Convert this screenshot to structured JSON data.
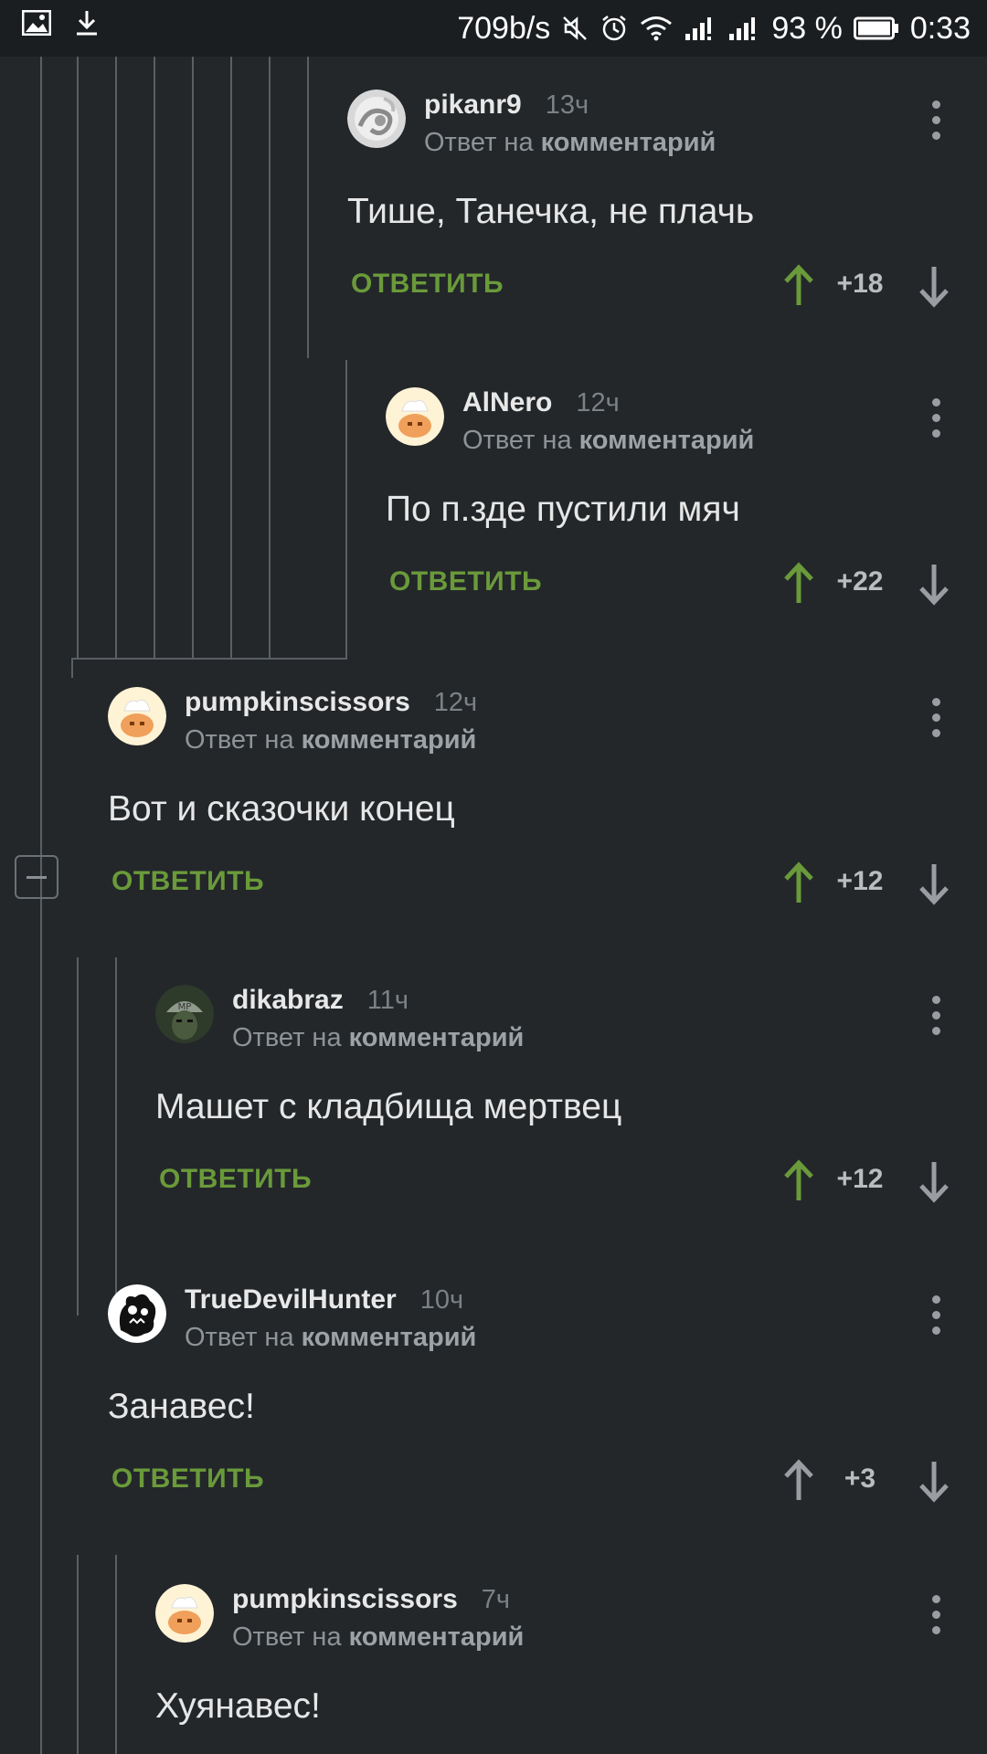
{
  "status_bar": {
    "network_speed": "709b/s",
    "battery_percent": "93 %",
    "clock": "0:33",
    "icons": [
      "image-icon",
      "download-icon",
      "mute-icon",
      "alarm-icon",
      "wifi-icon",
      "signal-icon",
      "signal-icon",
      "battery-icon"
    ]
  },
  "labels": {
    "reply_to_prefix": "Ответ на",
    "reply_to_target": "комментарий",
    "reply_button": "ОТВЕТИТЬ"
  },
  "colors": {
    "background": "#23272a",
    "reply_button": "#6a9a3a",
    "upvote_active": "#6a9a3a",
    "upvote_inactive": "#9a9ea2"
  },
  "comments": [
    {
      "author": "pikanr9",
      "time": "13ч",
      "text": "Тише, Танечка, не плачь",
      "score": "+18",
      "upvoted": true,
      "avatar": "swirl-avatar"
    },
    {
      "author": "AlNero",
      "time": "12ч",
      "text": "По п.зде пустили мяч",
      "score": "+22",
      "upvoted": true,
      "avatar": "pumpkin-avatar"
    },
    {
      "author": "pumpkinscissors",
      "time": "12ч",
      "text": "Вот и сказочки конец",
      "score": "+12",
      "upvoted": true,
      "avatar": "pumpkin-avatar"
    },
    {
      "author": "dikabraz",
      "time": "11ч",
      "text": "Машет с кладбища мертвец",
      "score": "+12",
      "upvoted": true,
      "avatar": "cap-avatar"
    },
    {
      "author": "TrueDevilHunter",
      "time": "10ч",
      "text": "Занавес!",
      "score": "+3",
      "upvoted": false,
      "avatar": "monster-avatar"
    },
    {
      "author": "pumpkinscissors",
      "time": "7ч",
      "text": "Хуянавес!",
      "score": "",
      "upvoted": false,
      "avatar": "pumpkin-avatar"
    }
  ]
}
